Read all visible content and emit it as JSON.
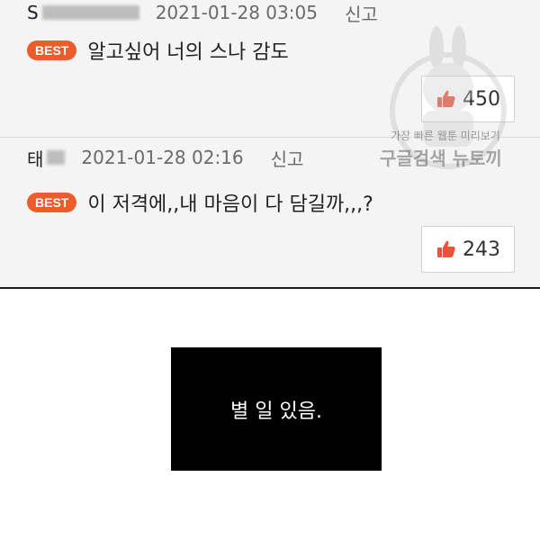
{
  "comments": [
    {
      "author": "S",
      "date": "2021-01-28 03:05",
      "report_label": "신고",
      "badge": "BEST",
      "text": "알고싶어 너의 스나 감도",
      "likes": "450"
    },
    {
      "author": "태",
      "date": "2021-01-28 02:16",
      "report_label": "신고",
      "badge": "BEST",
      "text": "이 저격에,,내 마음이 다 담길까,,,?",
      "likes": "243"
    }
  ],
  "panel": {
    "text": "별 일 있음."
  },
  "watermark": {
    "line1": "가장 빠른 웹툰 미리보기",
    "line2": "구글검색 뉴토끼"
  },
  "colors": {
    "best_badge": "#ee5c2c",
    "thumb": "#e8533a",
    "panel_bg": "#000000"
  },
  "icons": {
    "like": "thumbs-up-icon",
    "watermark": "bunny-mascot-icon"
  }
}
